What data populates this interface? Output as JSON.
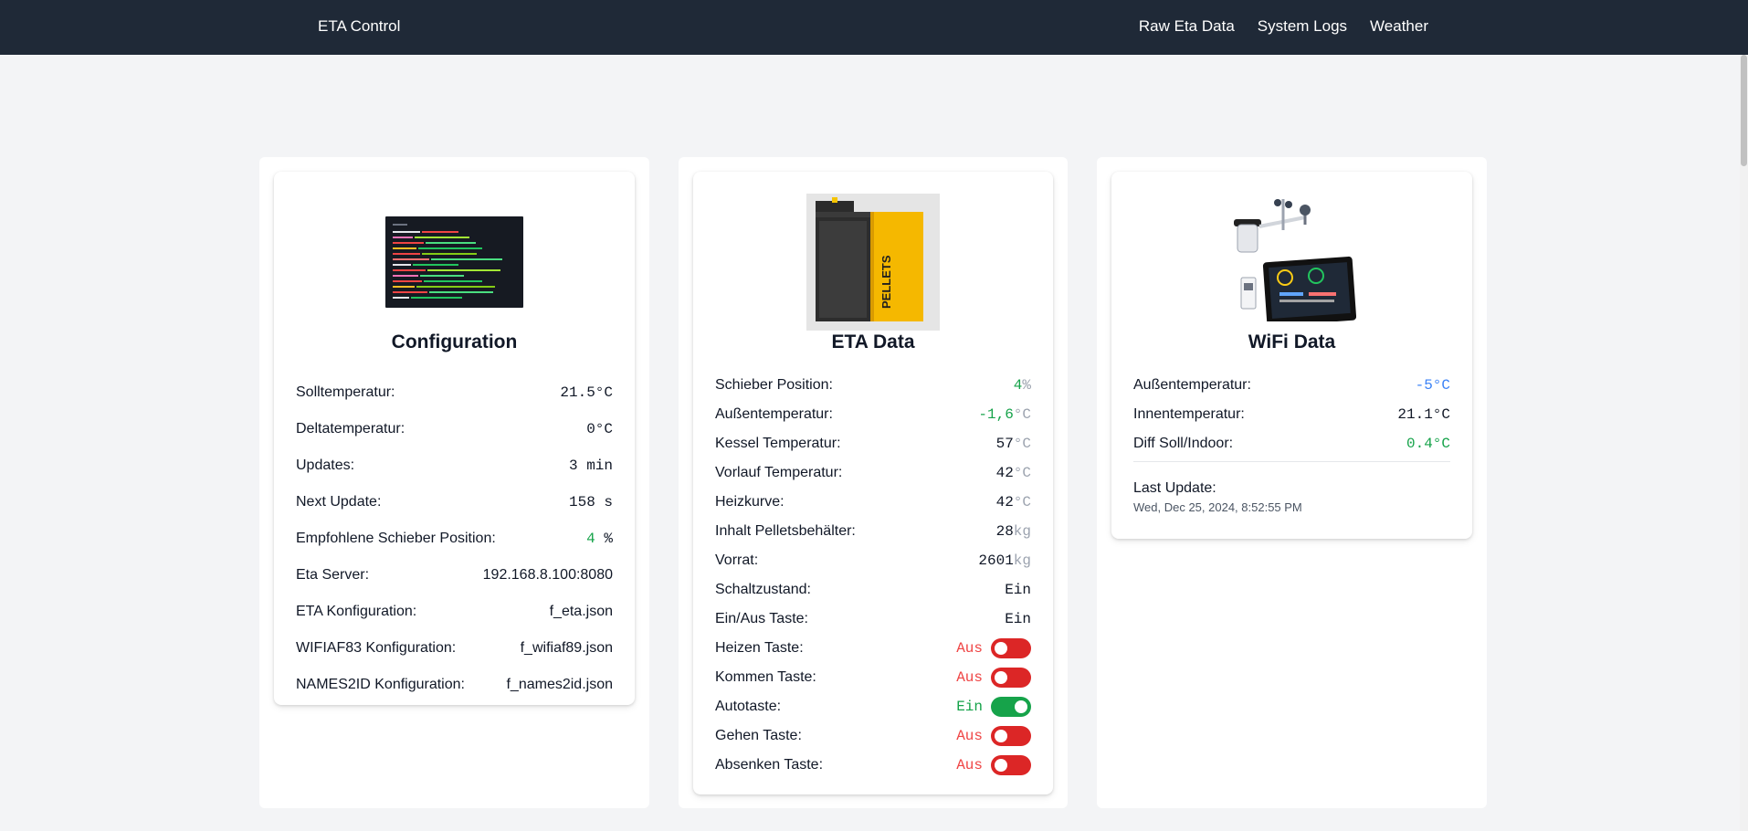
{
  "nav": {
    "brand": "ETA Control",
    "links": [
      "Raw Eta Data",
      "System Logs",
      "Weather"
    ]
  },
  "config": {
    "title": "Configuration",
    "rows": [
      {
        "label": "Solltemperatur:",
        "value": "21.5°C"
      },
      {
        "label": "Deltatemperatur:",
        "value": "0°C"
      },
      {
        "label": "Updates:",
        "value": "3 min"
      },
      {
        "label": "Next Update:",
        "value": "158 s"
      },
      {
        "label": "Empfohlene Schieber Position:",
        "value": "4",
        "unit": "%"
      },
      {
        "label": "Eta Server:",
        "value": "192.168.8.100:8080"
      },
      {
        "label": "ETA Konfiguration:",
        "value": "f_eta.json"
      },
      {
        "label": "WIFIAF83 Konfiguration:",
        "value": "f_wifiaf89.json"
      },
      {
        "label": "NAMES2ID Konfiguration:",
        "value": "f_names2id.json"
      }
    ]
  },
  "eta": {
    "title": "ETA Data",
    "rows": [
      {
        "label": "Schieber Position:",
        "value": "4",
        "unit": "%"
      },
      {
        "label": "Außentemperatur:",
        "value": "-1,6",
        "unit": "°C"
      },
      {
        "label": "Kessel Temperatur:",
        "value": "57",
        "unit": "°C"
      },
      {
        "label": "Vorlauf Temperatur:",
        "value": "42",
        "unit": "°C"
      },
      {
        "label": "Heizkurve:",
        "value": "42",
        "unit": "°C"
      },
      {
        "label": "Inhalt Pelletsbehälter:",
        "value": "28",
        "unit": "kg"
      },
      {
        "label": "Vorrat:",
        "value": "2601",
        "unit": "kg"
      },
      {
        "label": "Schaltzustand:",
        "value": "Ein"
      },
      {
        "label": "Ein/Aus Taste:",
        "value": "Ein"
      }
    ],
    "toggles": [
      {
        "label": "Heizen Taste:",
        "state": "Aus"
      },
      {
        "label": "Kommen Taste:",
        "state": "Aus"
      },
      {
        "label": "Autotaste:",
        "state": "Ein"
      },
      {
        "label": "Gehen Taste:",
        "state": "Aus"
      },
      {
        "label": "Absenken Taste:",
        "state": "Aus"
      }
    ],
    "pellet_label": "PELLETS"
  },
  "wifi": {
    "title": "WiFi Data",
    "rows": [
      {
        "label": "Außentemperatur:",
        "value": "-5°C"
      },
      {
        "label": "Innentemperatur:",
        "value": "21.1°C"
      },
      {
        "label": "Diff Soll/Indoor:",
        "value": "0.4°C"
      }
    ],
    "last_update_label": "Last Update:",
    "last_update_value": "Wed, Dec 25, 2024, 8:52:55 PM"
  },
  "colors": {
    "navbar": "#1f2937",
    "green": "#16a34a",
    "red": "#dc2626",
    "blue": "#3b82f6"
  }
}
